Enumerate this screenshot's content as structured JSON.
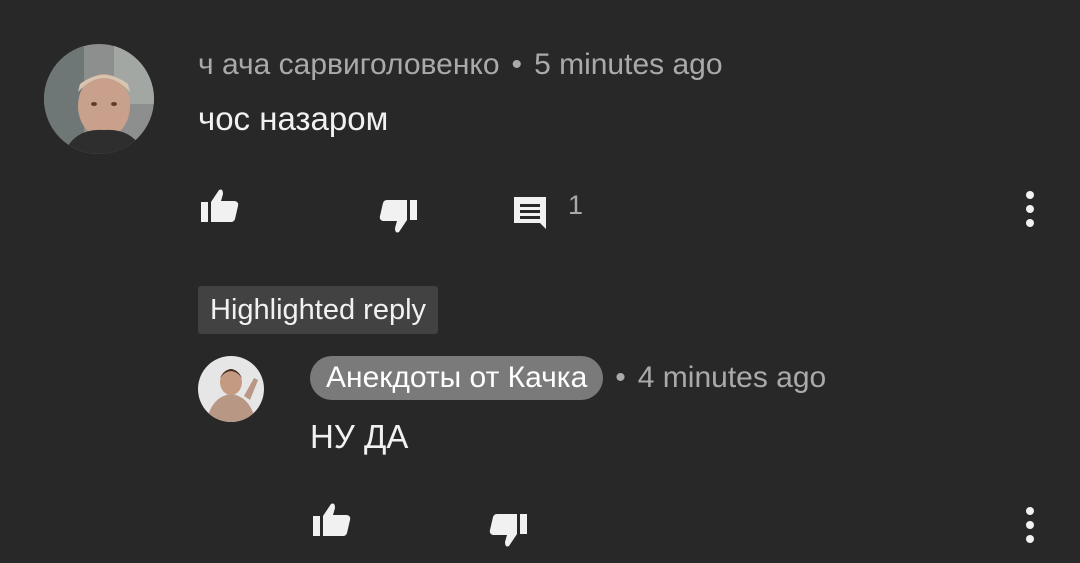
{
  "comment": {
    "author": "ч ача сарвиголовенко",
    "time": "5 minutes ago",
    "text": "чос назаром",
    "reply_count": "1",
    "icons": {
      "like": "thumbs-up-icon",
      "dislike": "thumbs-down-icon",
      "reply": "comment-icon",
      "menu": "more-vertical-icon"
    }
  },
  "highlight_label": "Highlighted reply",
  "reply": {
    "author": "Анекдоты от Качка",
    "time": "4 minutes ago",
    "text": "НУ ДА",
    "icons": {
      "like": "thumbs-up-icon",
      "dislike": "thumbs-down-icon",
      "menu": "more-vertical-icon"
    }
  },
  "colors": {
    "background": "#282828",
    "primary_text": "#f1f1f1",
    "secondary_text": "#aaaaaa",
    "badge": "#424242",
    "channel_pill": "#7a7a7a"
  }
}
